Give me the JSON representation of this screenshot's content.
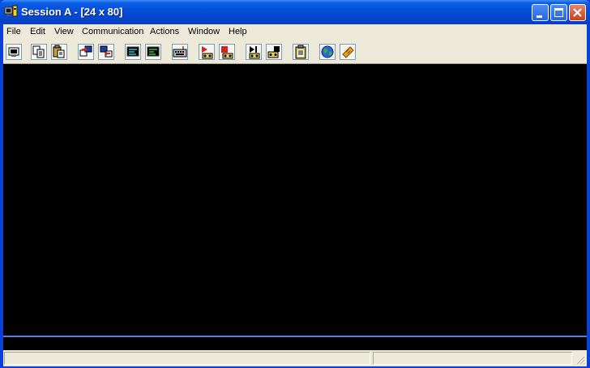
{
  "window": {
    "title": "Session A - [24 x 80]",
    "icon": "terminal-session-icon",
    "controls": [
      "minimize-icon",
      "maximize-icon",
      "close-icon"
    ]
  },
  "menu": {
    "items": [
      "File",
      "Edit",
      "View",
      "Communication",
      "Actions",
      "Window",
      "Help"
    ]
  },
  "toolbar": {
    "buttons": [
      "print-screen-icon",
      "copy-icon",
      "paste-icon",
      "send-file-icon",
      "receive-file-icon",
      "display-session-icon",
      "display-options-icon",
      "keyboard-map-icon",
      "record-macro-icon",
      "stop-macro-icon",
      "play-macro-icon",
      "pause-macro-icon",
      "clipboard-icon",
      "globe-icon",
      "help-icon"
    ]
  },
  "status": {
    "pane1": "",
    "pane2": ""
  },
  "colors": {
    "title_bar": "#0650da",
    "terminal_bg": "#000000",
    "oia_separator": "#5a7edc",
    "chrome": "#ece9d8"
  }
}
